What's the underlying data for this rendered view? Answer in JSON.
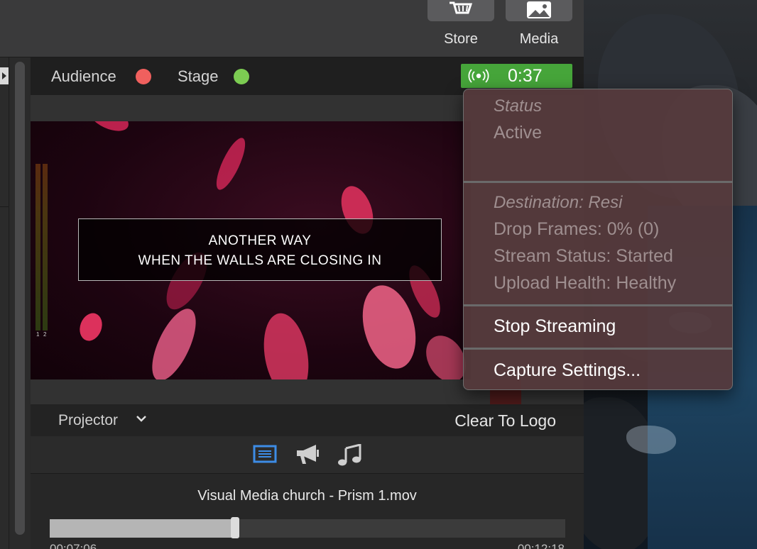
{
  "toolbar": {
    "store_label": "Store",
    "media_label": "Media"
  },
  "status": {
    "audience_label": "Audience",
    "audience_color": "#f0605e",
    "stage_label": "Stage",
    "stage_color": "#7ccc52",
    "live_timer": "0:37"
  },
  "preview": {
    "lyric_line1": "ANOTHER WAY",
    "lyric_line2": "WHEN THE WALLS ARE CLOSING IN",
    "meter_labels": [
      "1",
      "2"
    ]
  },
  "output": {
    "screen_label": "Projector",
    "clear_to_logo": "Clear To Logo"
  },
  "media": {
    "filename": "Visual Media church - Prism 1.mov",
    "elapsed": "00:07:06",
    "total": "00:12:18",
    "progress": 0.36
  },
  "menu": {
    "status_heading": "Status",
    "status_value": "Active",
    "destination": "Destination: Resi",
    "drop_frames": "Drop Frames: 0% (0)",
    "stream_status": "Stream Status: Started",
    "upload_health": "Upload Health: Healthy",
    "stop_streaming": "Stop Streaming",
    "capture_settings": "Capture Settings..."
  },
  "icons": {
    "store": "cart-icon",
    "media": "photo-icon",
    "broadcast": "broadcast-icon",
    "slides": "slides-icon",
    "announcements": "megaphone-icon",
    "audio": "music-note-icon",
    "dropdown": "chevron-down-icon"
  }
}
